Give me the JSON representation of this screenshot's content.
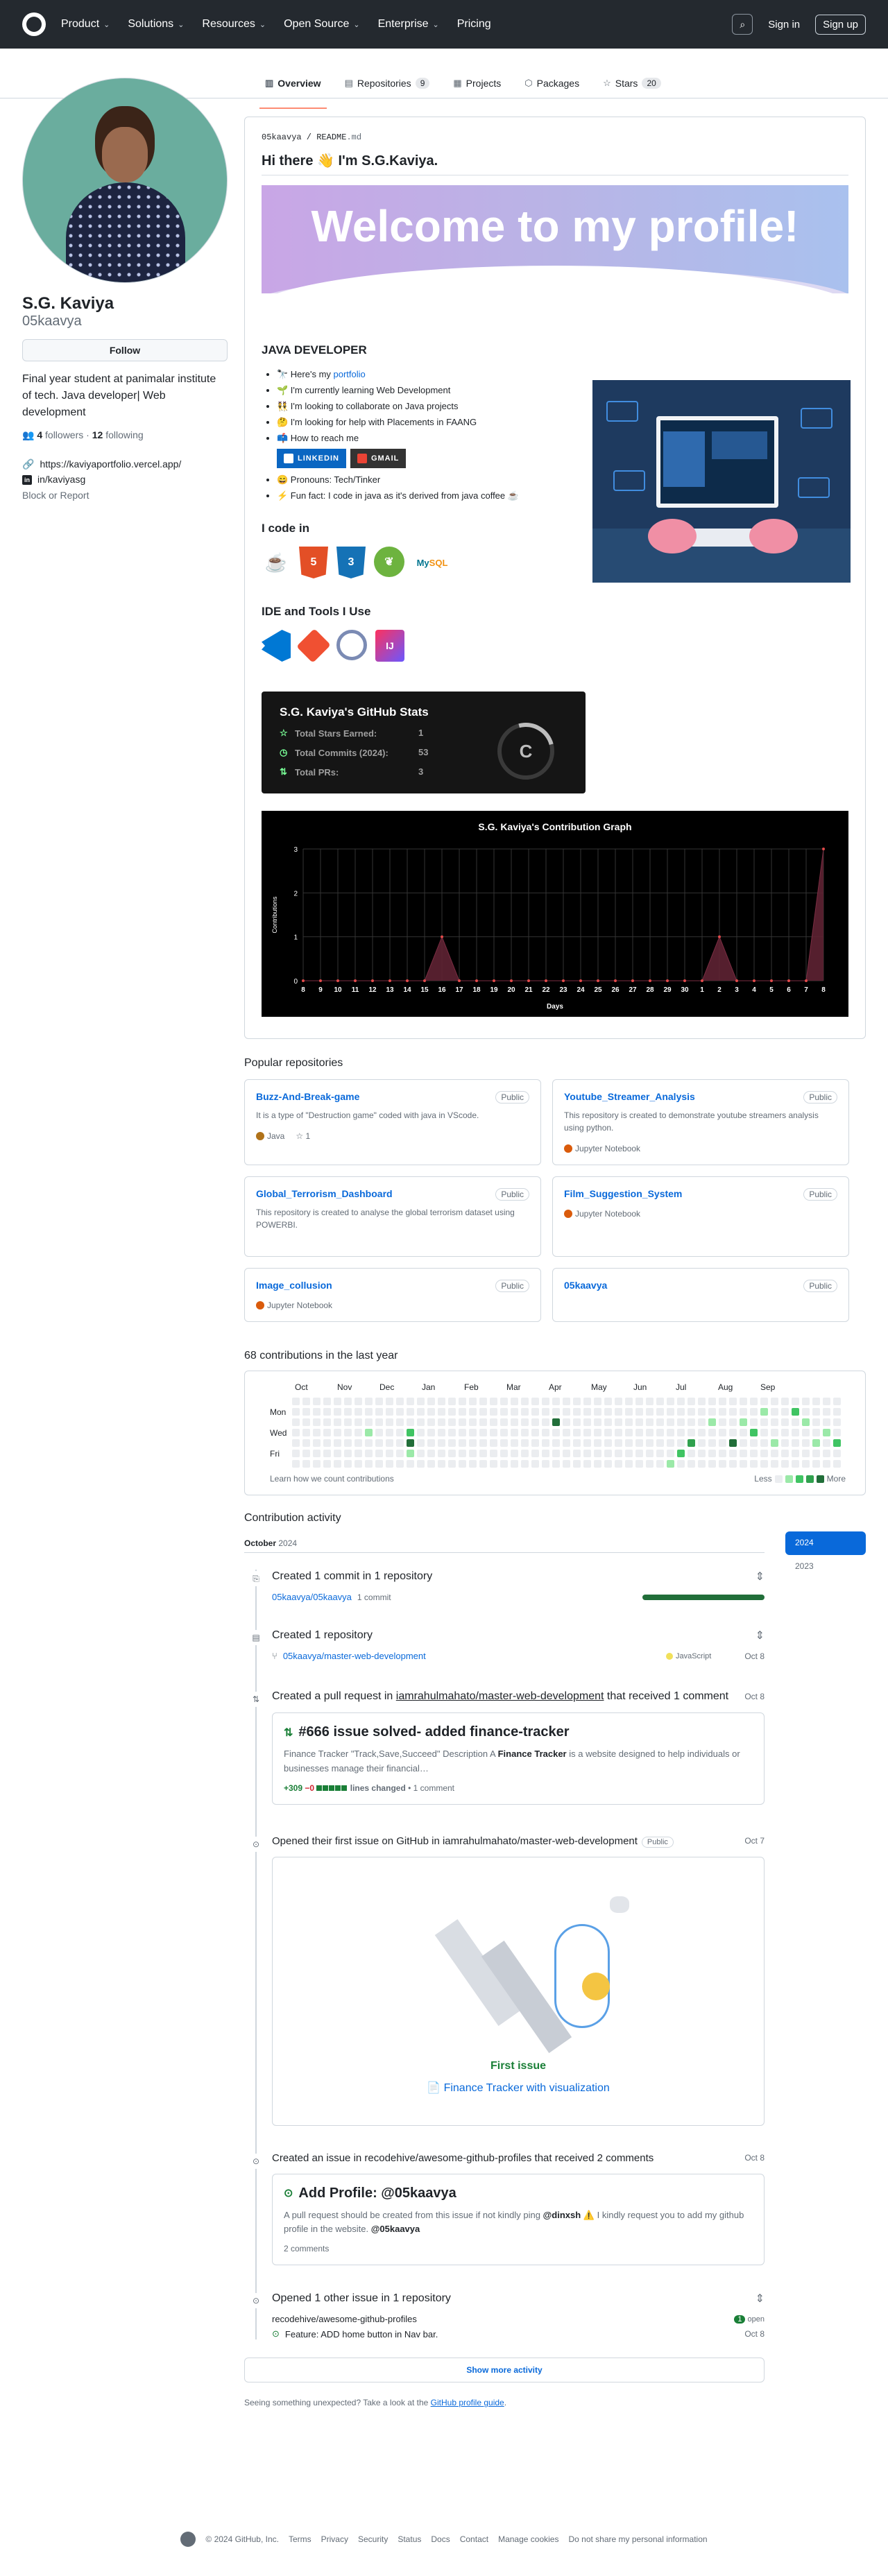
{
  "nav": {
    "items": [
      "Product",
      "Solutions",
      "Resources",
      "Open Source",
      "Enterprise",
      "Pricing"
    ],
    "sign_in": "Sign in",
    "sign_up": "Sign up"
  },
  "tabs": [
    {
      "label": "Overview",
      "count": ""
    },
    {
      "label": "Repositories",
      "count": "9"
    },
    {
      "label": "Projects",
      "count": ""
    },
    {
      "label": "Packages",
      "count": ""
    },
    {
      "label": "Stars",
      "count": "20"
    }
  ],
  "profile": {
    "name": "S.G. Kaviya",
    "login": "05kaavya",
    "follow": "Follow",
    "bio": "Final year student at panimalar institute of tech. Java developer| Web development",
    "followers": "4",
    "followers_label": "followers",
    "following": "12",
    "following_label": "following",
    "website": "https://kaviyaportfolio.vercel.app/",
    "linkedin": "in/kaviyasg",
    "block": "Block or Report"
  },
  "readme": {
    "path_user": "05kaavya",
    "path_file": "README",
    "path_ext": ".md",
    "greeting": "Hi there 👋 I'm S.G.Kaviya.",
    "banner": "Welcome to my profile!",
    "heading": "JAVA DEVELOPER",
    "bullets": [
      {
        "pre": "🔭 Here's my ",
        "link": "portfolio",
        "post": ""
      },
      {
        "pre": "🌱 I'm currently learning Web Development",
        "link": "",
        "post": ""
      },
      {
        "pre": "👯 I'm looking to collaborate on Java projects",
        "link": "",
        "post": ""
      },
      {
        "pre": "🤔 I'm looking for help with Placements in FAANG",
        "link": "",
        "post": ""
      },
      {
        "pre": "📫 How to reach me",
        "link": "",
        "post": ""
      },
      {
        "pre": "😄 Pronouns: Tech/Tinker",
        "link": "",
        "post": ""
      },
      {
        "pre": "⚡ Fun fact: I code in java as it's derived from java coffee ☕",
        "link": "",
        "post": ""
      }
    ],
    "badge_linkedin": "LINKEDIN",
    "badge_gmail": "GMAIL",
    "code_heading": "I code in",
    "tools_heading": "IDE and Tools I Use",
    "stats": {
      "title": "S.G. Kaviya's GitHub Stats",
      "rows": [
        {
          "label": "Total Stars Earned:",
          "value": "1"
        },
        {
          "label": "Total Commits (2024):",
          "value": "53"
        },
        {
          "label": "Total PRs:",
          "value": "3"
        }
      ],
      "grade": "C"
    }
  },
  "chart_data": {
    "type": "area",
    "title": "S.G. Kaviya's Contribution Graph",
    "xlabel": "Days",
    "ylabel": "Contributions",
    "x": [
      "8",
      "9",
      "10",
      "11",
      "12",
      "13",
      "14",
      "15",
      "16",
      "17",
      "18",
      "19",
      "20",
      "21",
      "22",
      "23",
      "24",
      "25",
      "26",
      "27",
      "28",
      "29",
      "30",
      "1",
      "2",
      "3",
      "4",
      "5",
      "6",
      "7",
      "8"
    ],
    "values": [
      0,
      0,
      0,
      0,
      0,
      0,
      0,
      0,
      1,
      0,
      0,
      0,
      0,
      0,
      0,
      0,
      0,
      0,
      0,
      0,
      0,
      0,
      0,
      0,
      1,
      0,
      0,
      0,
      0,
      0,
      3
    ],
    "yticks": [
      "0",
      "1",
      "2",
      "3"
    ],
    "ylim": [
      0,
      3
    ],
    "grid": true
  },
  "popular": {
    "title": "Popular repositories",
    "repos": [
      {
        "name": "Buzz-And-Break-game",
        "vis": "Public",
        "desc": "It is a type of \"Destruction game\" coded with java in VScode.",
        "lang": "Java",
        "color": "#b07219",
        "stars": "1"
      },
      {
        "name": "Youtube_Streamer_Analysis",
        "vis": "Public",
        "desc": "This repository is created to demonstrate youtube streamers analysis using python.",
        "lang": "Jupyter Notebook",
        "color": "#DA5B0B",
        "stars": ""
      },
      {
        "name": "Global_Terrorism_Dashboard",
        "vis": "Public",
        "desc": "This repository is created to analyse the global terrorism dataset using POWERBI.",
        "lang": "",
        "color": "",
        "stars": ""
      },
      {
        "name": "Film_Suggestion_System",
        "vis": "Public",
        "desc": "",
        "lang": "Jupyter Notebook",
        "color": "#DA5B0B",
        "stars": ""
      },
      {
        "name": "Image_collusion",
        "vis": "Public",
        "desc": "",
        "lang": "Jupyter Notebook",
        "color": "#DA5B0B",
        "stars": ""
      },
      {
        "name": "05kaavya",
        "vis": "Public",
        "desc": "",
        "lang": "",
        "color": "",
        "stars": ""
      }
    ]
  },
  "calendar": {
    "title": "68 contributions in the last year",
    "months": [
      "Oct",
      "Nov",
      "Dec",
      "Jan",
      "Feb",
      "Mar",
      "Apr",
      "May",
      "Jun",
      "Jul",
      "Aug",
      "Sep"
    ],
    "days": [
      "Mon",
      "Wed",
      "Fri"
    ],
    "learn": "Learn how we count contributions",
    "less": "Less",
    "more": "More"
  },
  "activity": {
    "title": "Contribution activity",
    "years": [
      "2024",
      "2023"
    ],
    "month": "October",
    "month_year": "2024",
    "items": {
      "commits": {
        "title": "Created 1 commit in 1 repository",
        "repo": "05kaavya/05kaavya",
        "count": "1 commit"
      },
      "repo": {
        "title": "Created 1 repository",
        "repo": "05kaavya/master-web-development",
        "lang": "JavaScript",
        "date": "Oct 8"
      },
      "pr": {
        "title_pre": "Created a pull request in ",
        "repo": "iamrahulmahato/master-web-development",
        "title_post": " that received 1 comment",
        "date": "Oct 8",
        "pr_title": "#666 issue solved- added finance-tracker",
        "pr_body_1": "Finance Tracker \"Track,Save,Succeed\" Description A ",
        "pr_body_b": "Finance Tracker",
        "pr_body_2": " is a website designed to help individuals or businesses manage their financial…",
        "additions": "+309",
        "deletions": "−0",
        "lines": "lines changed",
        "comments": "• 1 comment"
      },
      "first_issue": {
        "title": "Opened their first issue on GitHub in iamrahulmahato/master-web-development",
        "vis": "Public",
        "date": "Oct 7",
        "caption": "First issue",
        "link": "📄 Finance Tracker with visualization"
      },
      "issue": {
        "title": "Created an issue in recodehive/awesome-github-profiles that received 2 comments",
        "date": "Oct 8",
        "card_title": "Add Profile: @05kaavya",
        "body_1": "A pull request should be created from this issue if not kindly ping ",
        "body_b1": "@dinxsh",
        "body_2": " ⚠️ I kindly request you to add my github profile in the website. ",
        "body_b2": "@05kaavya",
        "comments": "2 comments"
      },
      "other": {
        "title": "Opened 1 other issue in 1 repository",
        "repo": "recodehive/awesome-github-profiles",
        "open_count": "1",
        "open_label": "open",
        "issue": "Feature: ADD home button in Nav bar.",
        "date": "Oct 8"
      }
    },
    "show_more": "Show more activity",
    "unexpected": "Seeing something unexpected? Take a look at the ",
    "guide": "GitHub profile guide",
    "guide_post": "."
  },
  "footer": {
    "copy": "© 2024 GitHub, Inc.",
    "links": [
      "Terms",
      "Privacy",
      "Security",
      "Status",
      "Docs",
      "Contact",
      "Manage cookies",
      "Do not share my personal information"
    ]
  }
}
